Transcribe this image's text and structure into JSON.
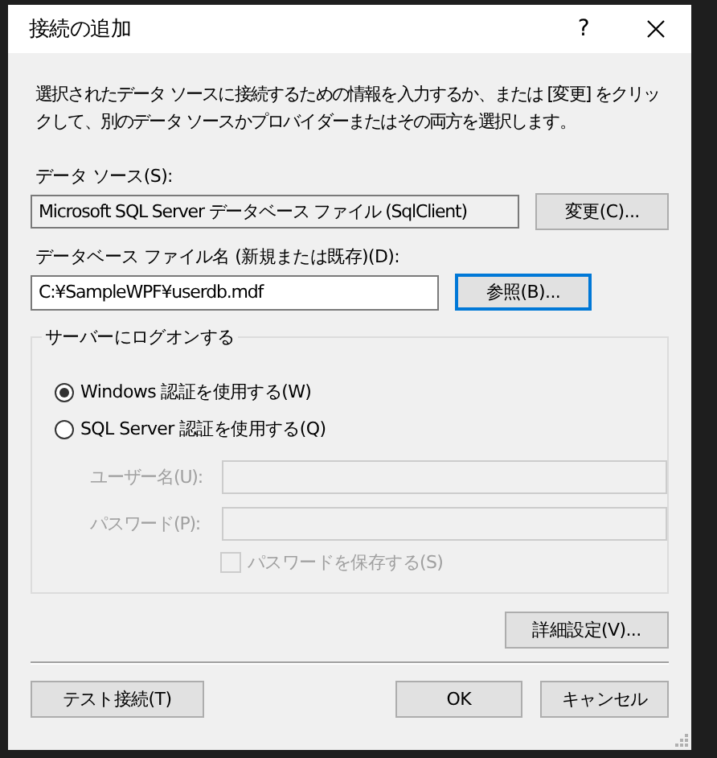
{
  "window": {
    "title": "接続の追加",
    "help_button": "?"
  },
  "description": "選択されたデータ ソースに接続するための情報を入力するか、または [変更] をクリックして、別のデータ ソースかプロバイダーまたはその両方を選択します。",
  "data_source": {
    "label": "データ ソース(S):",
    "value": "Microsoft SQL Server データベース ファイル (SqlClient)",
    "button": "変更(C)..."
  },
  "database_file": {
    "label": "データベース ファイル名 (新規または既存)(D):",
    "value": "C:¥SampleWPF¥userdb.mdf",
    "button": "参照(B)...",
    "button_focused": true
  },
  "logon": {
    "title": "サーバーにログオンする",
    "auth_options": [
      {
        "label": "Windows 認証を使用する(W)",
        "selected": true
      },
      {
        "label": "SQL Server 認証を使用する(Q)",
        "selected": false
      }
    ],
    "fields": [
      {
        "label": "ユーザー名(U):",
        "disabled": true
      },
      {
        "label": "パスワード(P):",
        "disabled": true
      }
    ],
    "save_password": {
      "label": "パスワードを保存する(S)",
      "checked": false,
      "disabled": true
    }
  },
  "advanced_button": "詳細設定(V)...",
  "buttons": [
    {
      "label": "テスト接続(T)"
    },
    {
      "label": "OK"
    },
    {
      "label": "キャンセル"
    }
  ]
}
